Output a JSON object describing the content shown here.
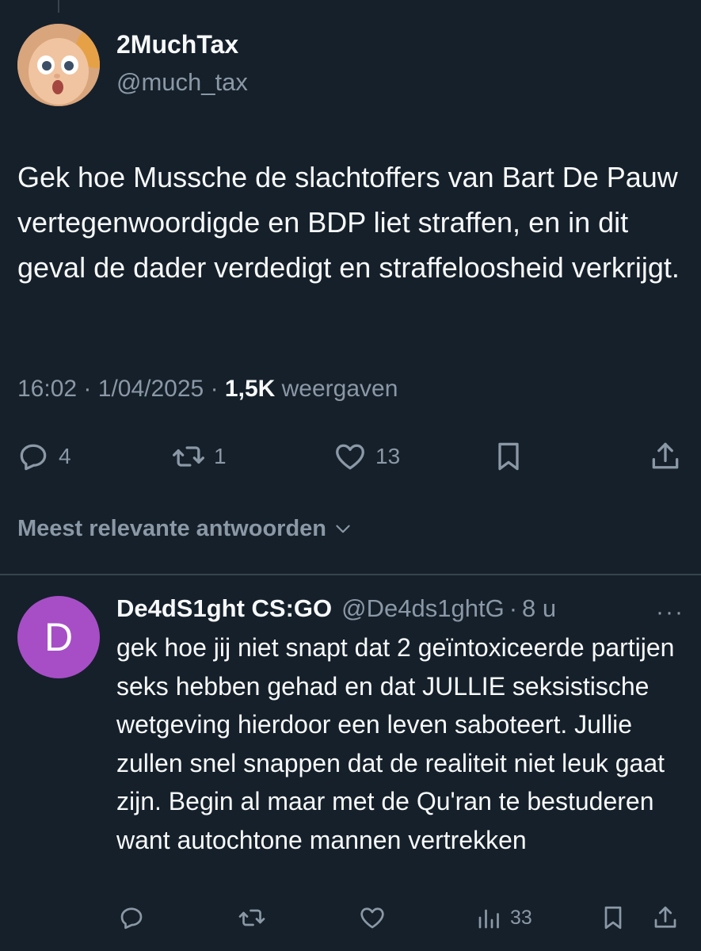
{
  "tweet": {
    "author_name": "2MuchTax",
    "author_handle": "@much_tax",
    "text": "Gek hoe Mussche de slachtoffers van Bart De Pauw vertegenwoordigde en BDP liet straffen, en in dit geval de dader verdedigt en straffeloosheid verkrijgt.",
    "time": "16:02",
    "separator": "·",
    "date": "1/04/2025",
    "views_count": "1,5K",
    "views_label": "weergaven",
    "actions": {
      "replies": "4",
      "reposts": "1",
      "likes": "13"
    }
  },
  "sort_label": "Meest relevante antwoorden",
  "reply": {
    "avatar_letter": "D",
    "author_name": "De4dS1ght CS:GO",
    "author_handle": "@De4ds1ghtG",
    "separator": "·",
    "time": "8 u",
    "more": "···",
    "text": "gek hoe jij niet snapt dat 2 geïntoxiceerde partijen seks hebben gehad en dat JULLIE seksistische wetgeving hierdoor een leven saboteert. Jullie zullen snel snappen dat de realiteit niet leuk gaat zijn. Begin al maar met de Qu'ran te bestuderen want autochtone mannen vertrekken",
    "views": "33"
  },
  "colors": {
    "background": "#15202b",
    "text": "#f7f9f9",
    "secondary": "#8b98a5",
    "divider": "#38444d",
    "reply_avatar": "#a74ec6"
  },
  "icons": [
    "reply-icon",
    "repost-icon",
    "like-icon",
    "bookmark-icon",
    "share-icon",
    "views-icon",
    "chevron-down-icon",
    "more-icon"
  ]
}
